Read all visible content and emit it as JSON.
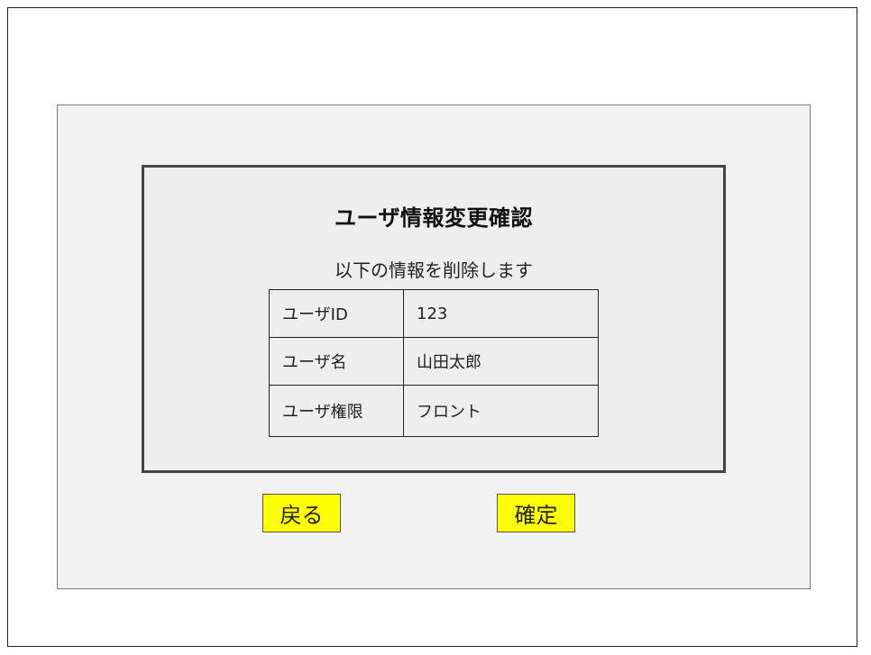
{
  "dialog": {
    "title": "ユーザ情報変更確認",
    "message": "以下の情報を削除します"
  },
  "user_info": [
    {
      "label": "ユーザID",
      "value": "123"
    },
    {
      "label": "ユーザ名",
      "value": "山田太郎"
    },
    {
      "label": "ユーザ権限",
      "value": "フロント"
    }
  ],
  "buttons": {
    "back_label": "戻る",
    "confirm_label": "確定"
  },
  "colors": {
    "button_background": "#ffff00",
    "panel_background": "#f2f2f2",
    "dialog_background": "#eeeeee"
  }
}
